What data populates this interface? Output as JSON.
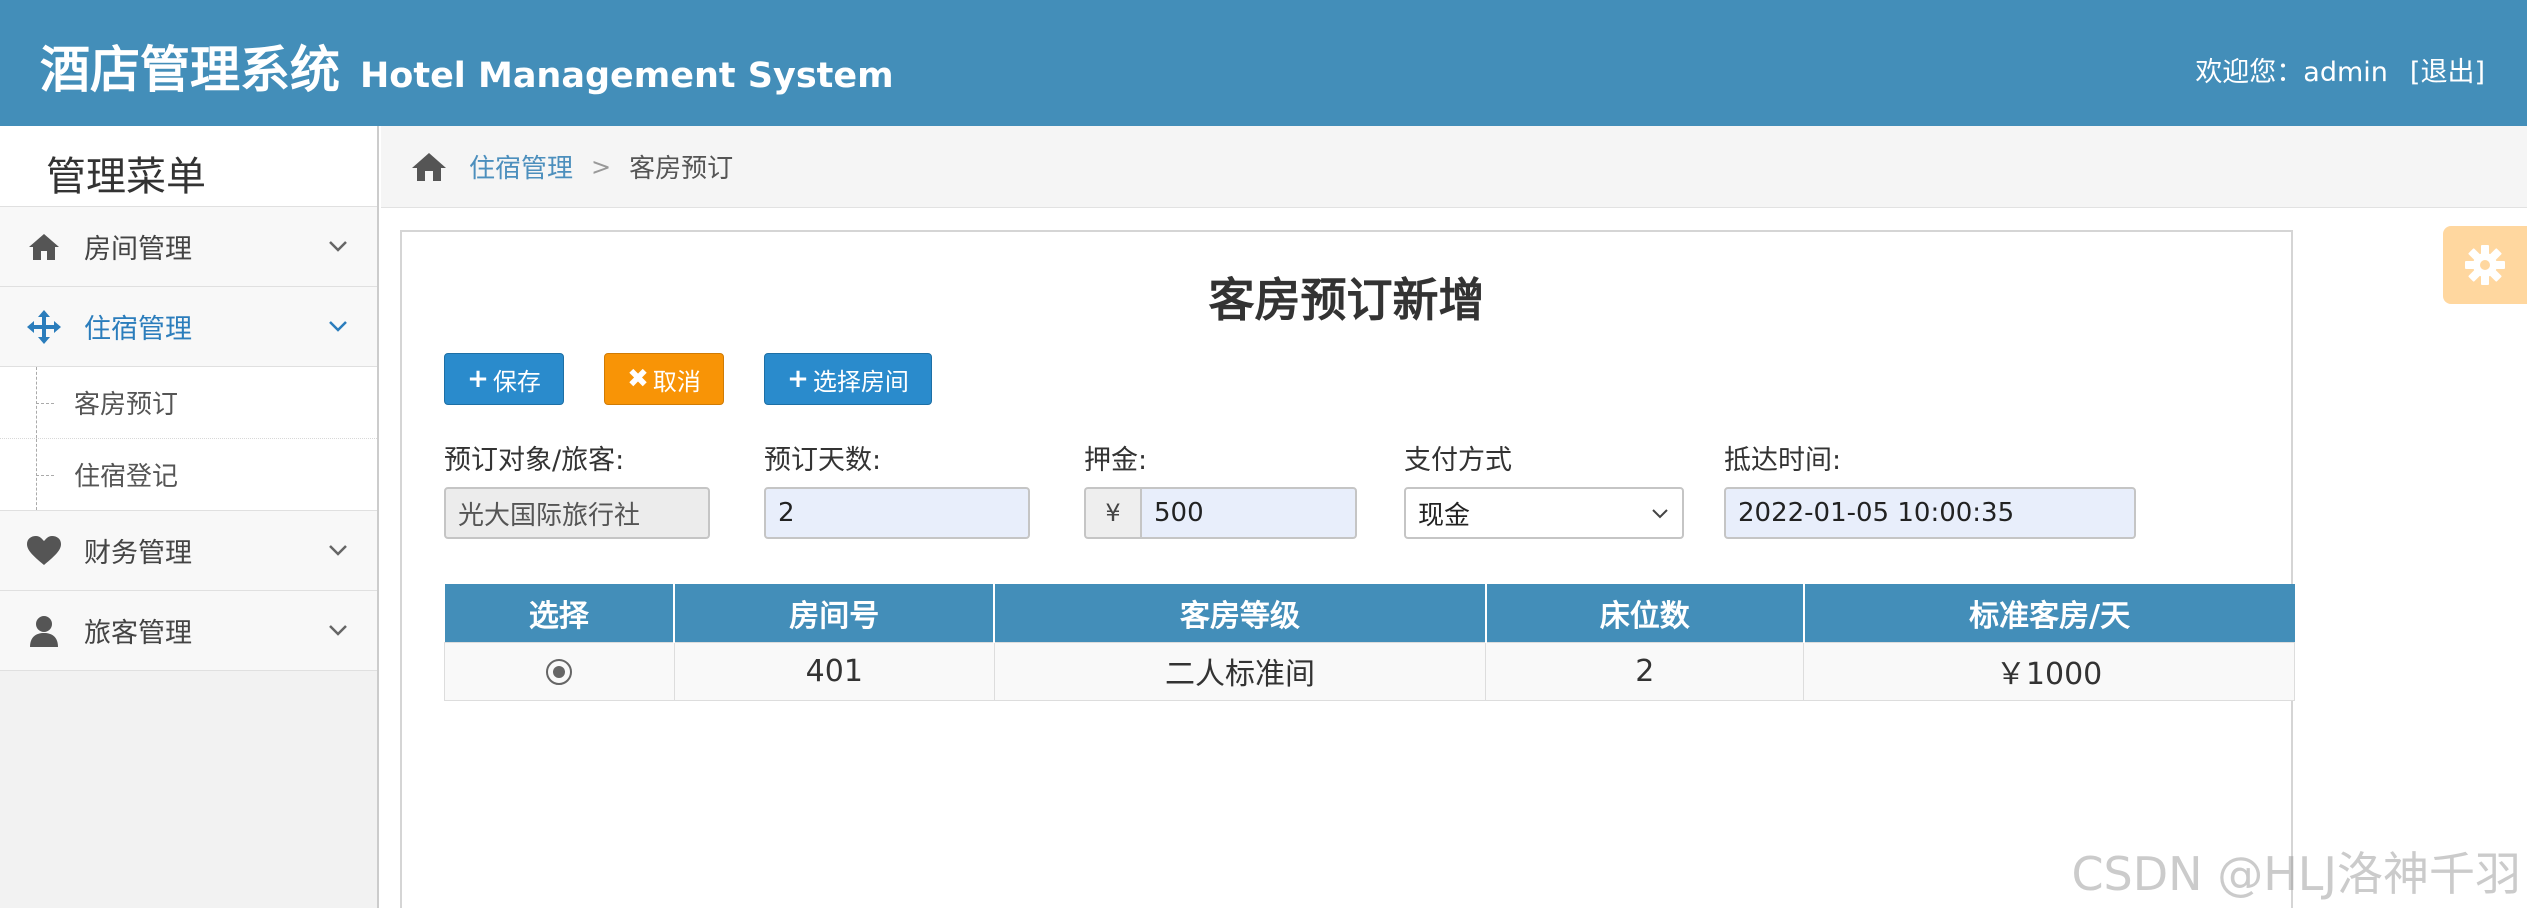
{
  "header": {
    "title_cn": "酒店管理系统",
    "title_en": "Hotel Management System",
    "welcome": "欢迎您：admin",
    "logout": "[退出]"
  },
  "sidebar": {
    "title": "管理菜单",
    "items": [
      {
        "label": "房间管理",
        "icon": "home-icon"
      },
      {
        "label": "住宿管理",
        "icon": "move-arrows-icon",
        "active": true,
        "children": [
          {
            "label": "客房预订"
          },
          {
            "label": "住宿登记"
          }
        ]
      },
      {
        "label": "财务管理",
        "icon": "heart-icon"
      },
      {
        "label": "旅客管理",
        "icon": "user-icon"
      }
    ]
  },
  "breadcrumb": {
    "parent": "住宿管理",
    "separator": ">",
    "current": "客房预订"
  },
  "form": {
    "title": "客房预订新增",
    "buttons": {
      "save": "保存",
      "cancel": "取消",
      "select_room": "选择房间"
    },
    "fields": {
      "guest_label": "预订对象/旅客:",
      "guest_value": "光大国际旅行社",
      "days_label": "预订天数:",
      "days_value": "2",
      "deposit_label": "押金:",
      "deposit_prefix": "¥",
      "deposit_value": "500",
      "payment_label": "支付方式",
      "payment_value": "现金",
      "arrival_label": "抵达时间:",
      "arrival_value": "2022-01-05 10:00:35"
    }
  },
  "table": {
    "headers": [
      "选择",
      "房间号",
      "客房等级",
      "床位数",
      "标准客房/天"
    ],
    "rows": [
      {
        "room_no": "401",
        "grade": "二人标准间",
        "beds": "2",
        "price": "￥1000"
      }
    ]
  },
  "watermark": "CSDN @HLJ洛神千羽",
  "colors": {
    "header_bg": "#438eb9",
    "primary_button": "#2a8bcc",
    "cancel_button": "#f89406",
    "settings_tab": "#ffb752"
  }
}
